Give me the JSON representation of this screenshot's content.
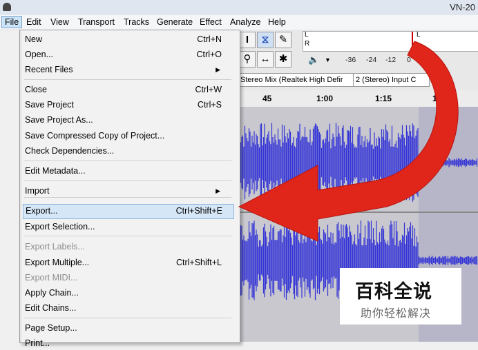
{
  "window": {
    "title": "VN-20"
  },
  "menubar": [
    "File",
    "Edit",
    "View",
    "Transport",
    "Tracks",
    "Generate",
    "Effect",
    "Analyze",
    "Help"
  ],
  "file_menu": {
    "items": [
      {
        "label": "New",
        "shortcut": "Ctrl+N",
        "enabled": true
      },
      {
        "label": "Open...",
        "shortcut": "Ctrl+O",
        "enabled": true
      },
      {
        "label": "Recent Files",
        "shortcut": "",
        "enabled": true,
        "submenu": true
      },
      {
        "label": "Close",
        "shortcut": "Ctrl+W",
        "enabled": true
      },
      {
        "label": "Save Project",
        "shortcut": "Ctrl+S",
        "enabled": true
      },
      {
        "label": "Save Project As...",
        "shortcut": "",
        "enabled": true
      },
      {
        "label": "Save Compressed Copy of Project...",
        "shortcut": "",
        "enabled": true
      },
      {
        "label": "Check Dependencies...",
        "shortcut": "",
        "enabled": true
      },
      {
        "label": "Edit Metadata...",
        "shortcut": "",
        "enabled": true
      },
      {
        "label": "Import",
        "shortcut": "",
        "enabled": true,
        "submenu": true
      },
      {
        "label": "Export...",
        "shortcut": "Ctrl+Shift+E",
        "enabled": true,
        "highlighted": true
      },
      {
        "label": "Export Selection...",
        "shortcut": "",
        "enabled": true
      },
      {
        "label": "Export Labels...",
        "shortcut": "",
        "enabled": false
      },
      {
        "label": "Export Multiple...",
        "shortcut": "Ctrl+Shift+L",
        "enabled": true
      },
      {
        "label": "Export MIDI...",
        "shortcut": "",
        "enabled": false
      },
      {
        "label": "Apply Chain...",
        "shortcut": "",
        "enabled": true
      },
      {
        "label": "Edit Chains...",
        "shortcut": "",
        "enabled": true
      },
      {
        "label": "Page Setup...",
        "shortcut": "",
        "enabled": true
      },
      {
        "label": "Print...",
        "shortcut": "",
        "enabled": true
      }
    ]
  },
  "meter": {
    "channel_left": "L",
    "channel_right": "R",
    "scale_labels": [
      "-36",
      "-24",
      "-12",
      "0"
    ]
  },
  "devices": {
    "recording_device": "Stereo Mix (Realtek High Defir",
    "channels": "2 (Stereo) Input C"
  },
  "timeline": {
    "ticks": [
      "45",
      "1:00",
      "1:15",
      "1:30"
    ]
  },
  "watermark": {
    "title": "百科全说",
    "subtitle": "助你轻松解决"
  },
  "colors": {
    "waveform": "#3434d6",
    "arrow": "#e0261a",
    "highlight": "#d5e6f7"
  },
  "icons": [
    "ibeam-tool-icon",
    "envelope-tool-icon",
    "draw-tool-icon",
    "zoom-tool-icon",
    "timeshift-tool-icon",
    "multi-tool-icon",
    "speaker-icon",
    "microphone-icon"
  ]
}
